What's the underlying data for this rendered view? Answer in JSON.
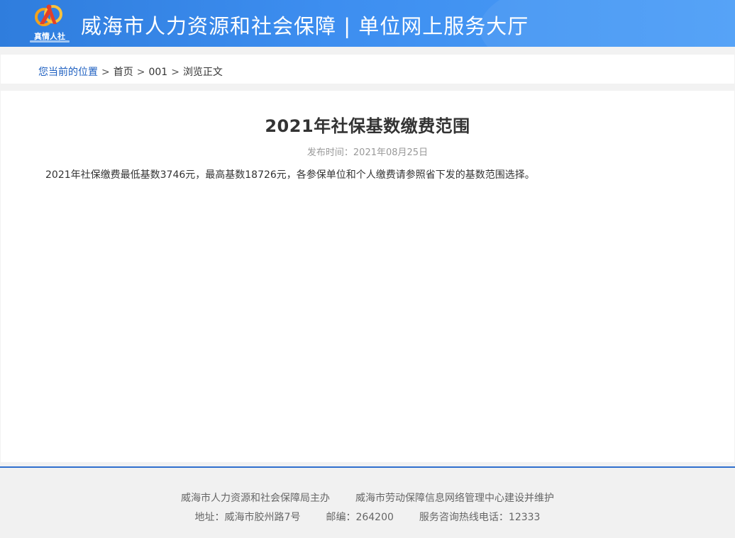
{
  "header": {
    "logo_text": "真情人社",
    "site_title": "威海市人力资源和社会保障 | 单位网上服务大厅",
    "colors": {
      "primary": "#2f7ddd",
      "logo_orange": "#f3a21c",
      "logo_red": "#e2402a"
    }
  },
  "breadcrumb": {
    "location_label": "您当前的位置",
    "separator": ">",
    "items": [
      "首页",
      "001",
      "浏览正文"
    ]
  },
  "article": {
    "title": "2021年社保基数缴费范围",
    "publish_time": "发布时间：2021年08月25日",
    "body": "2021年社保缴费最低基数3746元，最高基数18726元，各参保单位和个人缴费请参照省下发的基数范围选择。"
  },
  "footer": {
    "organizer": "威海市人力资源和社会保障局主办",
    "maintainer": "威海市劳动保障信息网络管理中心建设并维护",
    "address": "地址：威海市胶州路7号",
    "postcode": "邮编：264200",
    "hotline": "服务咨询热线电话：12333"
  }
}
